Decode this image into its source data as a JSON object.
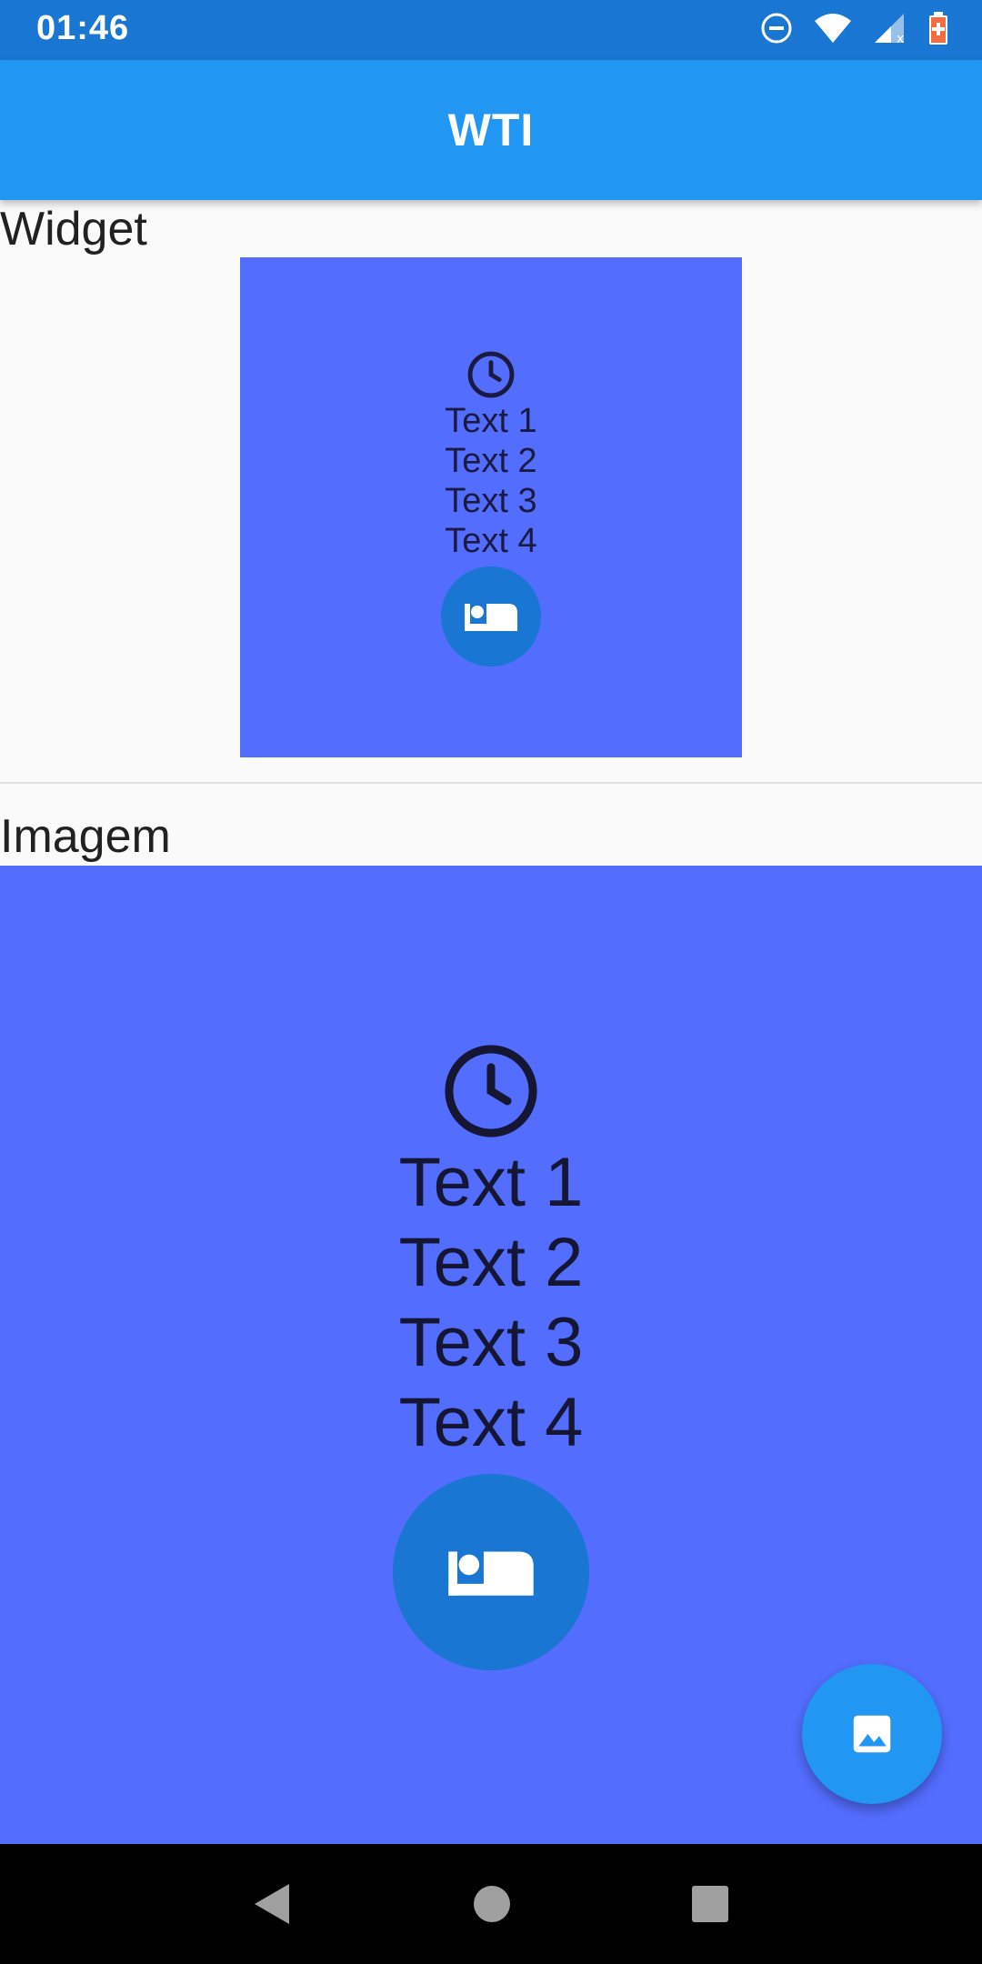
{
  "status_bar": {
    "time": "01:46"
  },
  "app_bar": {
    "title": "WTI"
  },
  "sections": {
    "widget_label": "Widget",
    "image_label": "Imagem"
  },
  "widget_card": {
    "lines": [
      "Text 1",
      "Text 2",
      "Text 3",
      "Text 4"
    ],
    "top_icon": "clock-icon",
    "bottom_icon": "hotel-bed-icon"
  },
  "image_card": {
    "lines": [
      "Text 1",
      "Text 2",
      "Text 3",
      "Text 4"
    ],
    "top_icon": "clock-icon",
    "bottom_icon": "hotel-bed-icon"
  },
  "fab": {
    "icon": "image-icon"
  },
  "colors": {
    "status_bar": "#1976d2",
    "app_bar": "#2196f3",
    "card_bg": "#536dfe",
    "circle": "#1976d2",
    "fab": "#2196f3"
  }
}
